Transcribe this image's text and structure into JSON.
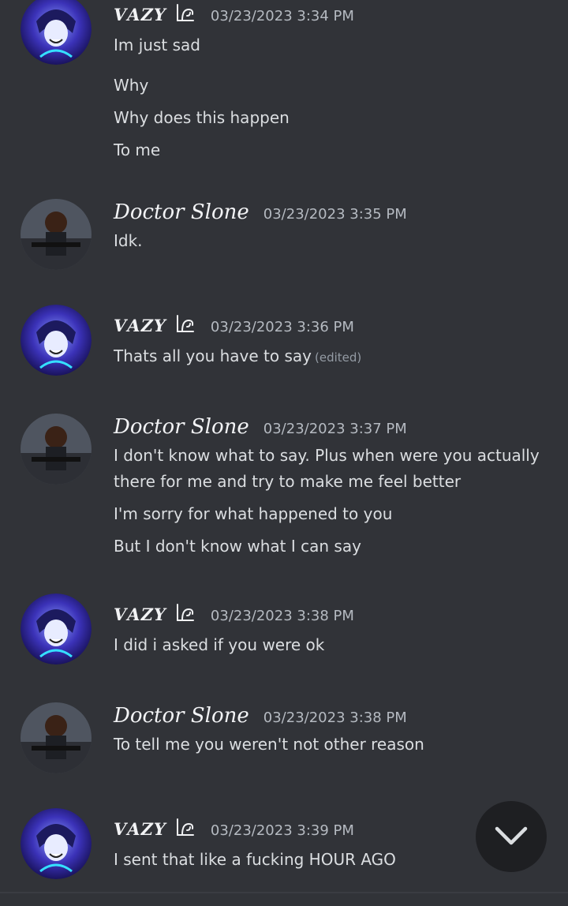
{
  "messages": [
    {
      "author": "𝑽𝑨𝒁𝒀",
      "timestamp": "03/23/2023 3:34 PM",
      "lines": [
        "Im just sad",
        "Why",
        "Why does this happen",
        "To me"
      ]
    },
    {
      "author": "Doctor Slone",
      "timestamp": "03/23/2023 3:35 PM",
      "lines": [
        "Idk."
      ]
    },
    {
      "author": "𝑽𝑨𝒁𝒀",
      "timestamp": "03/23/2023 3:36 PM",
      "lines": [
        "Thats all you have to say"
      ],
      "edited": "(edited)"
    },
    {
      "author": "Doctor Slone",
      "timestamp": "03/23/2023 3:37 PM",
      "lines": [
        "I don't know what to say. Plus when were you actually",
        "there for me and try to make me feel better",
        "I'm sorry for what happened to you",
        "But I don't know what I can say"
      ]
    },
    {
      "author": "𝑽𝑨𝒁𝒀",
      "timestamp": "03/23/2023 3:38 PM",
      "lines": [
        "I did i asked if you were ok"
      ]
    },
    {
      "author": "Doctor Slone",
      "timestamp": "03/23/2023 3:38 PM",
      "lines": [
        "To tell me you weren't not other reason"
      ]
    },
    {
      "author": "𝑽𝑨𝒁𝒀",
      "timestamp": "03/23/2023 3:39 PM",
      "lines": [
        "I sent that like a fucking HOUR AGO"
      ]
    }
  ],
  "scroll_button": {
    "icon": "chevron-down-icon"
  },
  "colors": {
    "background": "#313338",
    "text": "#dbdee1",
    "timestamp": "#b5bac1",
    "username": "#f2f3f5",
    "scroll_button": "#1e1f22"
  }
}
